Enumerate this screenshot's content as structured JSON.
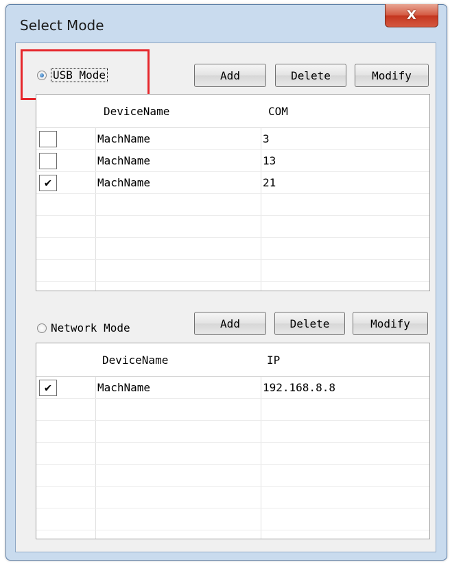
{
  "window": {
    "title": "Select Mode",
    "close_label": "X"
  },
  "usb": {
    "mode_label": "USB Mode",
    "buttons": {
      "add": "Add",
      "delete": "Delete",
      "modify": "Modify"
    },
    "columns": [
      "DeviceName",
      "COM"
    ],
    "rows": [
      {
        "checked": false,
        "name": "MachName",
        "value": "3"
      },
      {
        "checked": false,
        "name": "MachName",
        "value": "13"
      },
      {
        "checked": true,
        "name": "MachName",
        "value": "21"
      }
    ]
  },
  "network": {
    "mode_label": "Network Mode",
    "buttons": {
      "add": "Add",
      "delete": "Delete",
      "modify": "Modify"
    },
    "columns": [
      "DeviceName",
      "IP"
    ],
    "rows": [
      {
        "checked": true,
        "name": "MachName",
        "value": "192.168.8.8"
      }
    ]
  },
  "colors": {
    "highlight": "#e6262b",
    "window_frame": "#c9dbee",
    "close_button": "#c4361f"
  }
}
